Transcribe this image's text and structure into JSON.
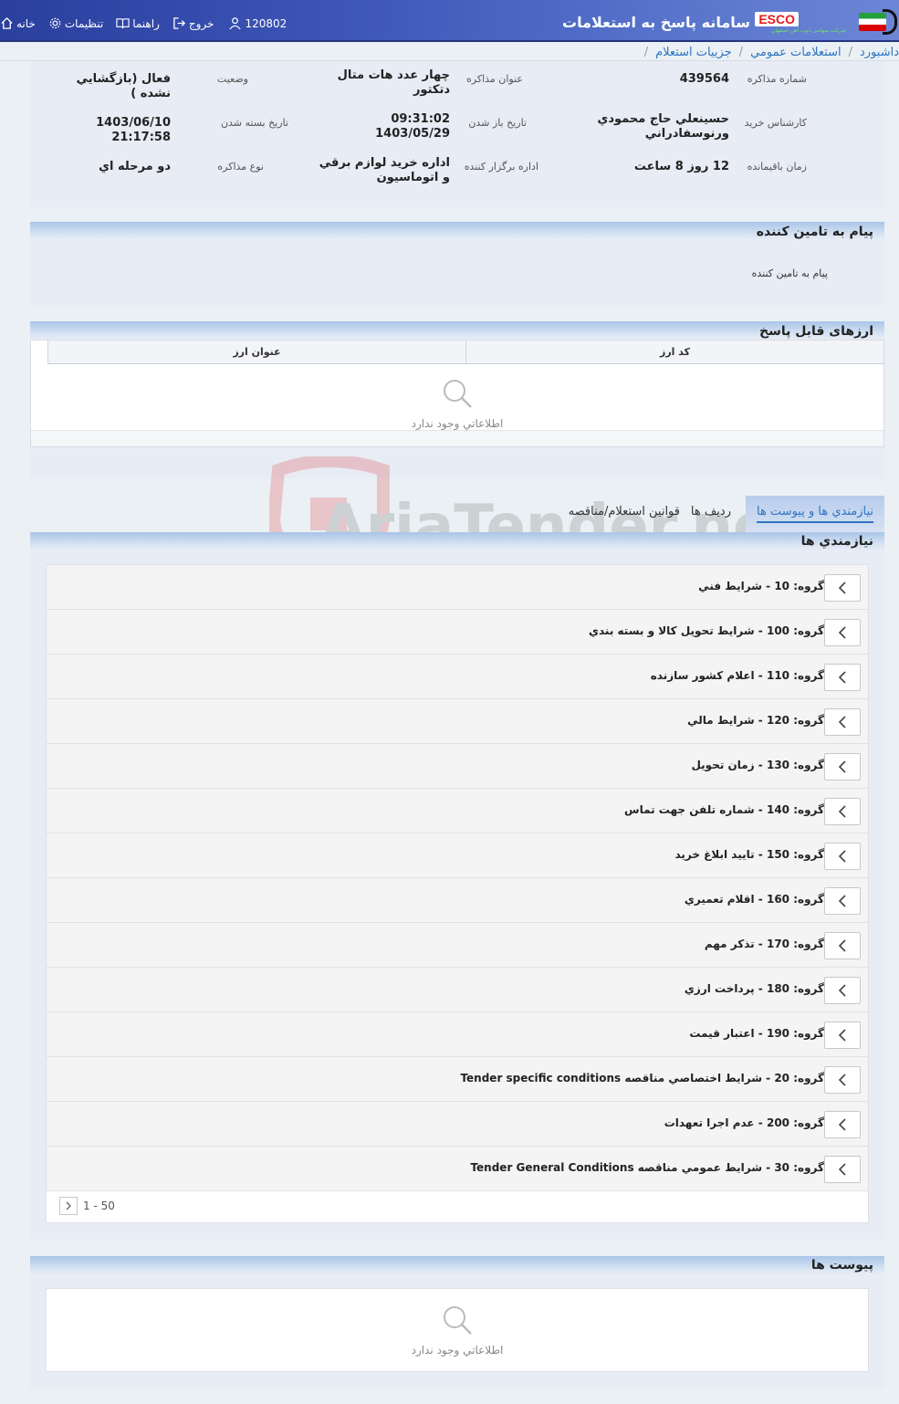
{
  "header": {
    "app_title": "سامانه پاسخ به استعلامات",
    "brand": "ESCO",
    "brand_sub": "شرکت سهامی ذوب آهن اصفهان",
    "nav": {
      "home": "خانه",
      "settings": "تنظیمات",
      "guide": "راهنما",
      "logout": "خروج",
      "user_id": "120802"
    }
  },
  "breadcrumb": [
    "داشبورد",
    "استعلامات عمومي",
    "جزييات استعلام"
  ],
  "summary": {
    "labels": {
      "number": "شماره مذاکره",
      "title": "عنوان مذاکره",
      "status": "وضعیت",
      "expert": "کارشناس خريد",
      "open_date": "تاريخ باز شدن",
      "close_date": "تاریخ بسته شدن",
      "remaining": "زمان باقيمانده",
      "office": "اداره برگزار کننده",
      "type": "نوع مذاکره"
    },
    "values": {
      "number": "439564",
      "title": "چهار عدد هات متال دتكتور",
      "status": "فعال (بازگشايي نشده )",
      "expert": "حسينعلي حاج محمودي ورنوسفادراني",
      "open_date": "09:31:02 1403/05/29",
      "close_date": "1403/06/10 21:17:58",
      "remaining": "12 روز 8 ساعت",
      "office": "اداره خريد لوازم برقي و اتوماسيون",
      "type": "دو مرحله اي"
    }
  },
  "message_panel": {
    "title": "پیام به تامین کننده",
    "text": "پیام به تامین کننده"
  },
  "currency_panel": {
    "title": "ارزهای قابل پاسخ",
    "columns": [
      "کد ارز",
      "عنوان ارز"
    ],
    "empty_text": "اطلاعاتي وجود ندارد"
  },
  "tabs": {
    "active": "نیازمندي ها و پيوست ها",
    "rows": "رديف ها",
    "rules": "قوانین استعلام/مناقصه"
  },
  "requirements": {
    "title": "نیازمندي ها",
    "groups": [
      "گروه: 10 - شرايط فني",
      "گروه: 100 - شرايط تحويل كالا و بسته بندي",
      "گروه: 110 - اعلام كشور سازنده",
      "گروه: 120 - شرايط مالي",
      "گروه: 130 - زمان تحويل",
      "گروه: 140 - شماره تلفن جهت تماس",
      "گروه: 150 - تاييد ابلاغ خريد",
      "گروه: 160 - اقلام تعميري",
      "گروه: 170 - تذكر مهم",
      "گروه: 180 - پرداخت ارزي",
      "گروه: 190 - اعتبار قيمت",
      "گروه: 20 - شرايط اختصاصي مناقصه Tender specific conditions",
      "گروه: 200 - عدم اجرا تعهدات",
      "گروه: 30 - شرايط عمومي مناقصه Tender General Conditions"
    ],
    "pager": "1 - 50"
  },
  "attachments": {
    "title": "پیوست ها",
    "empty_text": "اطلاعاتي وجود ندارد"
  },
  "watermark": "AriaTender.neT"
}
